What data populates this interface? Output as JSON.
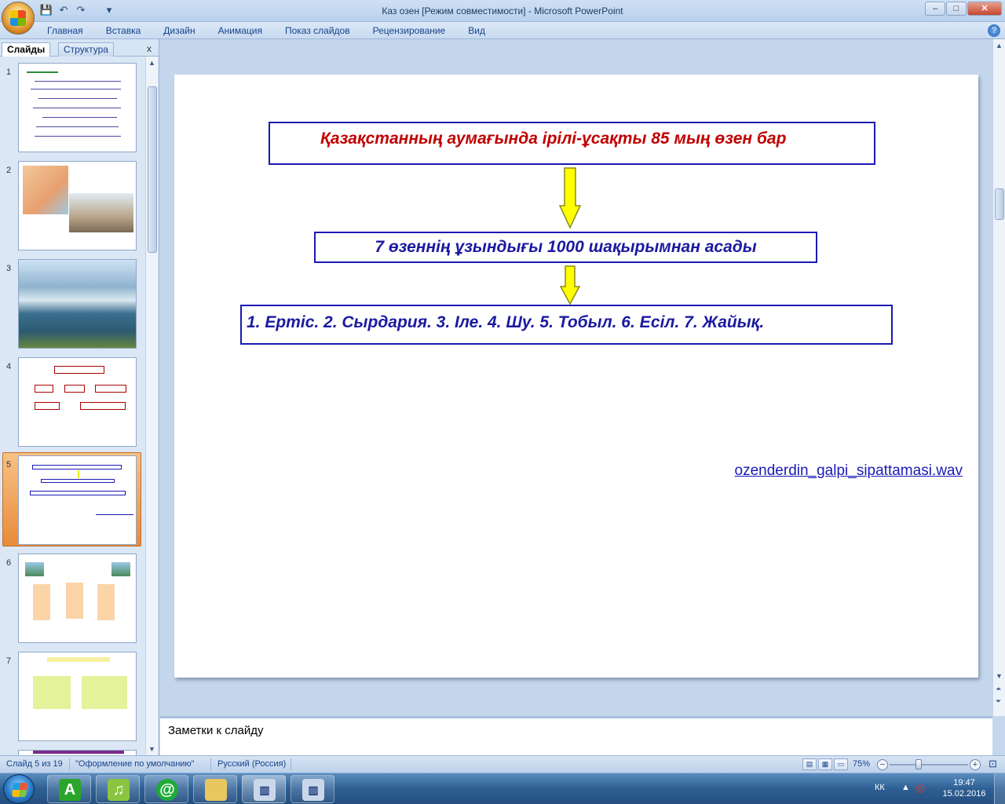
{
  "window": {
    "title": "Каз озен [Режим совместимости] - Microsoft PowerPoint",
    "minimize": "–",
    "maximize": "□",
    "close": "✕"
  },
  "qat": {
    "save_icon": "💾",
    "undo_icon": "↶",
    "redo_icon": "↷",
    "more_icon": "▾"
  },
  "ribbon": {
    "tabs": [
      "Главная",
      "Вставка",
      "Дизайн",
      "Анимация",
      "Показ слайдов",
      "Рецензирование",
      "Вид"
    ],
    "help": "?"
  },
  "left_panel": {
    "tab_slides": "Слайды",
    "tab_outline": "Структура",
    "close": "x",
    "slides": [
      {
        "num": "1"
      },
      {
        "num": "2"
      },
      {
        "num": "3"
      },
      {
        "num": "4"
      },
      {
        "num": "5",
        "selected": true
      },
      {
        "num": "6"
      },
      {
        "num": "7"
      }
    ]
  },
  "slide": {
    "box1": "Қазақстанның  аумағында  ірілі-ұсақты 85 мың өзен бар",
    "box2": "7 өзеннің ұзындығы 1000 шақырымнан  асады",
    "box3": "1. Ертіс.  2. Сырдария.  3. Іле.  4. Шу.  5. Тобыл.  6. Есіл.  7. Жайық.",
    "link": "ozenderdin_galpi_sipattamasi.wav",
    "arrow_color": "#ffff00"
  },
  "notes": {
    "placeholder": "Заметки к слайду"
  },
  "status": {
    "slide_counter": "Слайд 5 из 19",
    "theme": "\"Оформление по умолчанию\"",
    "language": "Русский (Россия)",
    "zoom": "75%",
    "zoom_out": "−",
    "zoom_in": "+"
  },
  "taskbar": {
    "lang": "КК",
    "time": "19:47",
    "date": "15.02.2016"
  }
}
